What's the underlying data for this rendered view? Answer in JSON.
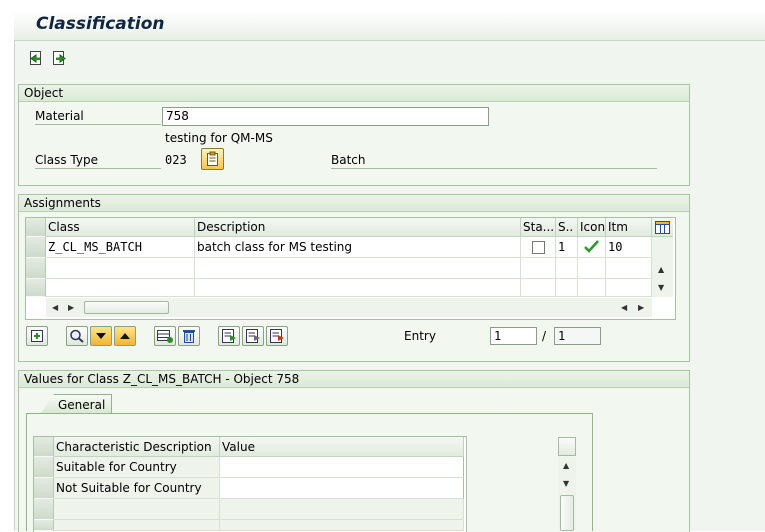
{
  "app": {
    "title": "Classification"
  },
  "toolbar": {
    "icons": [
      "previous-object-icon",
      "next-object-icon"
    ]
  },
  "object": {
    "header": "Object",
    "material_label": "Material",
    "material_value": "758",
    "material_desc": "testing for QM-MS",
    "class_type_label": "Class Type",
    "class_type_value": "023",
    "class_type_desc": "Batch"
  },
  "assignments": {
    "header": "Assignments",
    "columns": [
      "Class",
      "Description",
      "Sta...",
      "S..",
      "Icon",
      "Itm"
    ],
    "rows": [
      {
        "class": "Z_CL_MS_BATCH",
        "description": "batch class for MS testing",
        "status_checked": false,
        "s": "1",
        "icon": "checkmark-icon",
        "itm": "10"
      }
    ],
    "entry_label": "Entry",
    "entry_value": "1",
    "entry_sep": "/",
    "entry_total": "1"
  },
  "values": {
    "header": "Values for Class Z_CL_MS_BATCH - Object 758",
    "tab_label": "General",
    "columns": [
      "Characteristic Description",
      "Value"
    ],
    "rows": [
      {
        "desc": "Suitable for Country",
        "value": ""
      },
      {
        "desc": "Not Suitable for Country",
        "value": ""
      }
    ]
  },
  "colors": {
    "frame": "#f0f5ef",
    "group_border": "#a9c3a3",
    "title": "#10273f",
    "check": "#2e9a2e",
    "yellow_button": "#f2b533"
  }
}
